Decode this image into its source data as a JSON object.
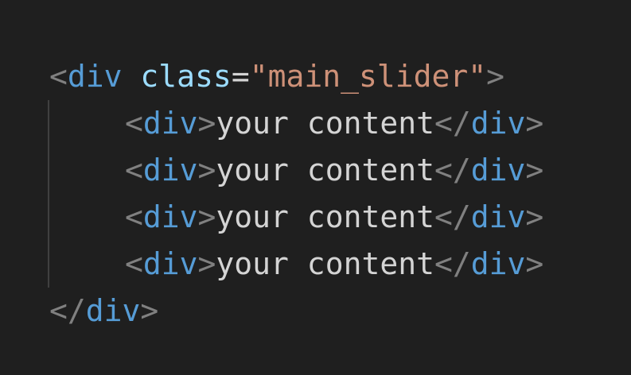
{
  "code": {
    "line1": {
      "open_bracket": "<",
      "tag": "div",
      "space": " ",
      "attr": "class",
      "eq": "=",
      "value": "\"main_slider\"",
      "close_bracket": ">"
    },
    "children": [
      {
        "open1": "<",
        "tag1": "div",
        "close1": ">",
        "text": "your content",
        "open2": "</",
        "tag2": "div",
        "close2": ">"
      },
      {
        "open1": "<",
        "tag1": "div",
        "close1": ">",
        "text": "your content",
        "open2": "</",
        "tag2": "div",
        "close2": ">"
      },
      {
        "open1": "<",
        "tag1": "div",
        "close1": ">",
        "text": "your content",
        "open2": "</",
        "tag2": "div",
        "close2": ">"
      },
      {
        "open1": "<",
        "tag1": "div",
        "close1": ">",
        "text": "your content",
        "open2": "</",
        "tag2": "div",
        "close2": ">"
      }
    ],
    "closing": {
      "open_bracket": "</",
      "tag": "div",
      "close_bracket": ">"
    }
  },
  "colors": {
    "background": "#1f1f1f",
    "bracket": "#808080",
    "tag": "#569cd6",
    "attribute": "#9cdcfe",
    "string": "#ce9178",
    "text": "#d4d4d4",
    "indent_guide": "#404040"
  }
}
